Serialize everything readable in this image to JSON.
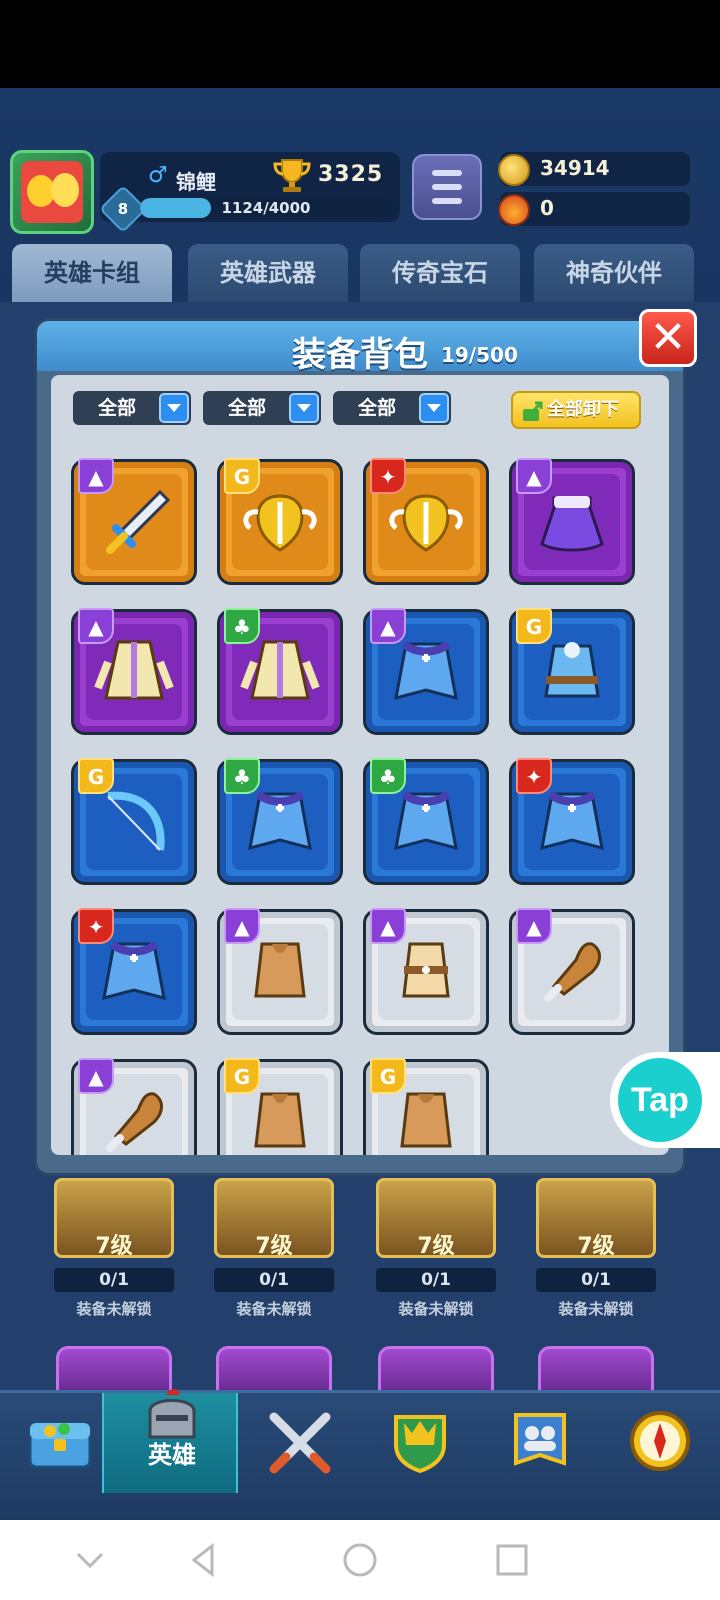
{
  "header": {
    "player_name": "锦鲤",
    "trophies": "3325",
    "level": "8",
    "xp_text": "1124/4000",
    "xp_fraction": 0.281,
    "gold": "34914",
    "fire_tokens": "0",
    "icons": {
      "gender": "male-icon",
      "trophy": "trophy-icon",
      "gold": "gold-coin-icon",
      "fire": "fire-token-icon",
      "menu": "hamburger-menu-icon"
    }
  },
  "tabs": [
    {
      "label": "英雄卡组",
      "active": true
    },
    {
      "label": "英雄武器",
      "active": false
    },
    {
      "label": "传奇宝石",
      "active": false
    },
    {
      "label": "神奇伙伴",
      "active": false
    }
  ],
  "modal": {
    "title": "装备背包",
    "capacity": "19/500",
    "close_icon": "close-icon",
    "filters": [
      "全部",
      "全部",
      "全部"
    ],
    "unequip_all": "全部卸下",
    "items": [
      {
        "rarity": "orange",
        "tag": "purple",
        "art": "sword"
      },
      {
        "rarity": "orange",
        "tag": "gold",
        "art": "winged-shield"
      },
      {
        "rarity": "orange",
        "tag": "red",
        "art": "winged-shield"
      },
      {
        "rarity": "purple",
        "tag": "purple",
        "art": "skirt"
      },
      {
        "rarity": "purple",
        "tag": "purple",
        "art": "robe"
      },
      {
        "rarity": "purple",
        "tag": "green",
        "art": "robe"
      },
      {
        "rarity": "blue",
        "tag": "purple",
        "art": "cape"
      },
      {
        "rarity": "blue",
        "tag": "gold",
        "art": "coat"
      },
      {
        "rarity": "blue",
        "tag": "gold",
        "art": "bow"
      },
      {
        "rarity": "blue",
        "tag": "green",
        "art": "cape"
      },
      {
        "rarity": "blue",
        "tag": "green",
        "art": "cape"
      },
      {
        "rarity": "blue",
        "tag": "red",
        "art": "cape"
      },
      {
        "rarity": "blue",
        "tag": "red",
        "art": "cape"
      },
      {
        "rarity": "white",
        "tag": "purple",
        "art": "vest"
      },
      {
        "rarity": "white",
        "tag": "purple",
        "art": "leather-armor"
      },
      {
        "rarity": "white",
        "tag": "purple",
        "art": "club"
      },
      {
        "rarity": "white",
        "tag": "purple",
        "art": "club"
      },
      {
        "rarity": "white",
        "tag": "gold",
        "art": "vest"
      },
      {
        "rarity": "white",
        "tag": "gold",
        "art": "vest"
      }
    ]
  },
  "background_cards": [
    {
      "level": "7级",
      "count": "0/1",
      "lock": "装备未解锁"
    },
    {
      "level": "7级",
      "count": "0/1",
      "lock": "装备未解锁"
    },
    {
      "level": "7级",
      "count": "0/1",
      "lock": "装备未解锁"
    },
    {
      "level": "7级",
      "count": "0/1",
      "lock": "装备未解锁"
    }
  ],
  "bottom_nav": [
    {
      "icon": "treasure-chest-icon",
      "label": ""
    },
    {
      "icon": "knight-helmet-icon",
      "label": "英雄",
      "active": true
    },
    {
      "icon": "crossed-swords-icon",
      "label": ""
    },
    {
      "icon": "crown-shield-icon",
      "label": ""
    },
    {
      "icon": "team-banner-icon",
      "label": ""
    },
    {
      "icon": "compass-icon",
      "label": ""
    }
  ],
  "tap_badge": "Tap",
  "system_nav": {
    "icons": [
      "back-chevron-icon",
      "back-triangle-icon",
      "home-circle-icon",
      "recents-square-icon"
    ]
  }
}
